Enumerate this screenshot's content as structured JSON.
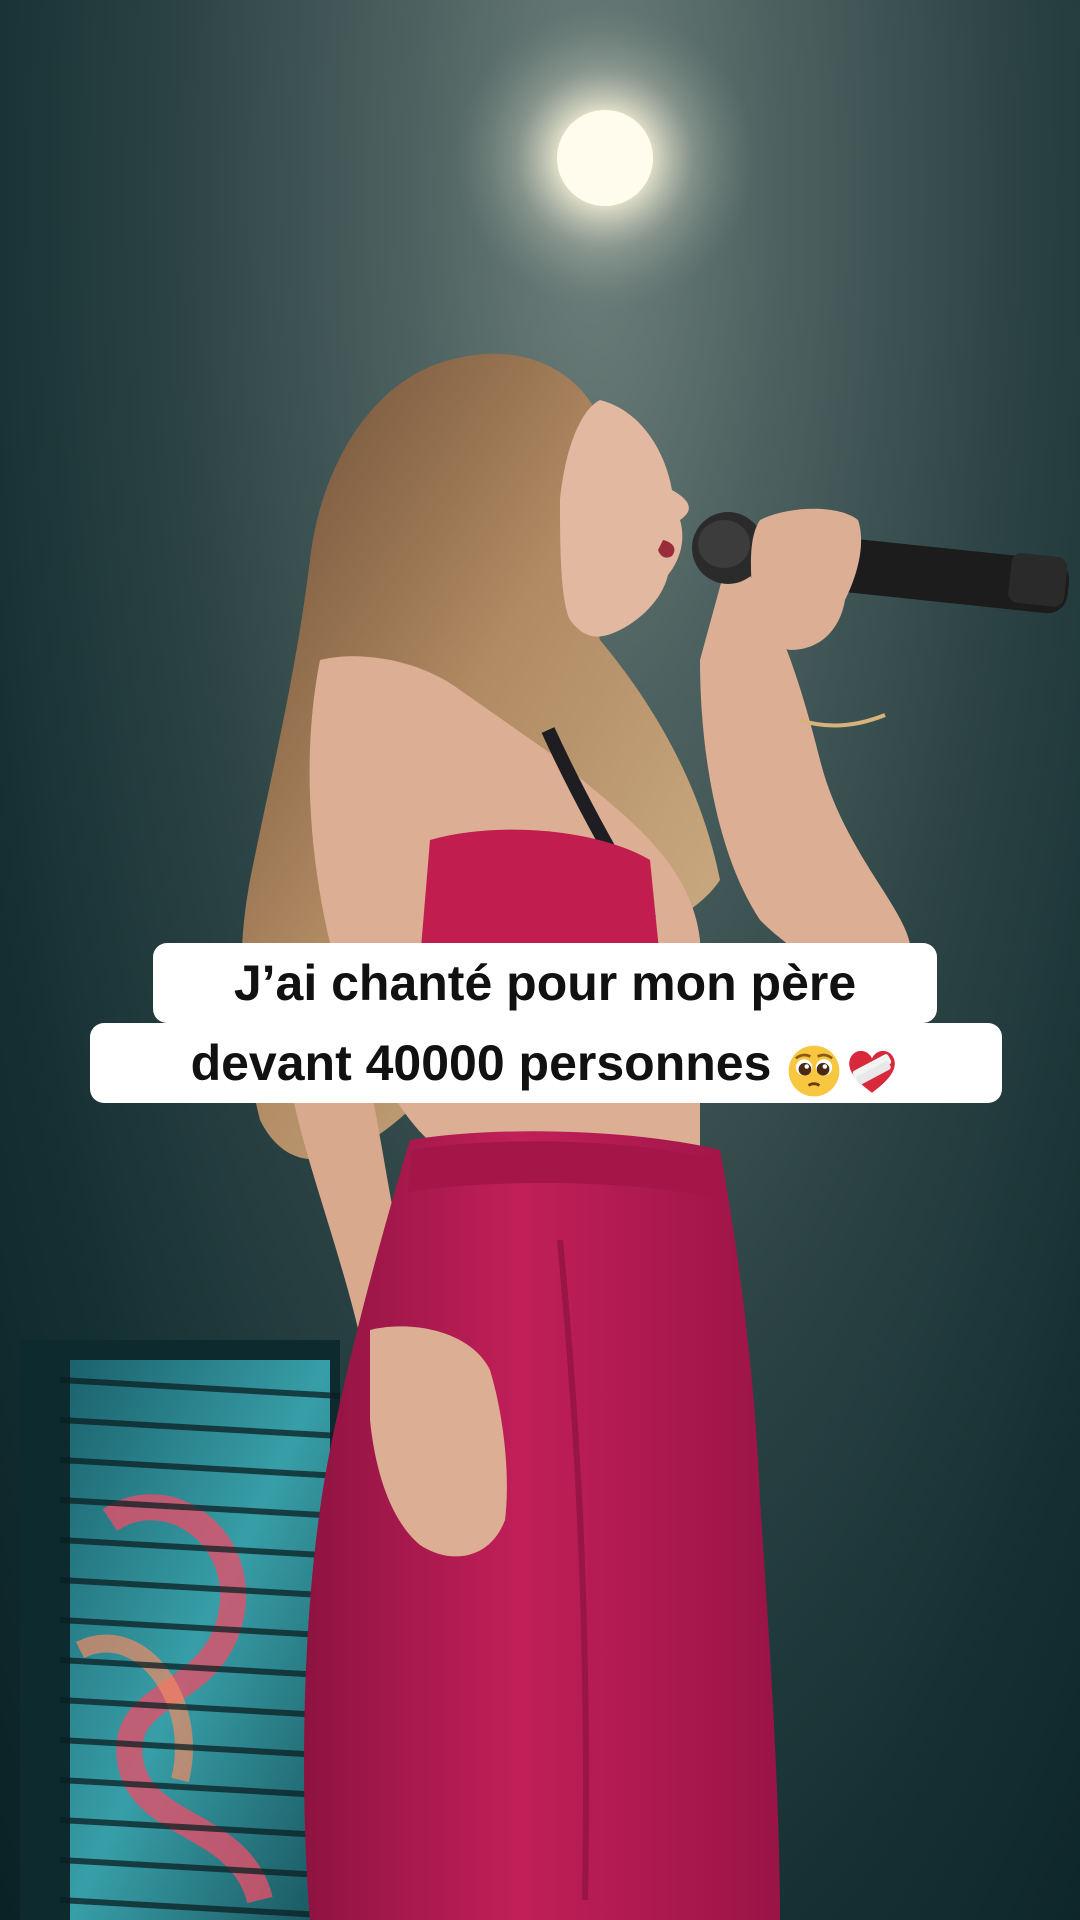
{
  "caption": {
    "line1": "J’ai chanté pour mon père",
    "line2": "devant 40000 personnes",
    "emojis": [
      "pleading-face-icon",
      "mending-heart-icon"
    ]
  },
  "colors": {
    "stage_background": "#1c3436",
    "top_color": "#c21d4f",
    "shorts_color": "#b81a52",
    "hair_color": "#a07a55",
    "skin_color": "#e0b59c"
  }
}
